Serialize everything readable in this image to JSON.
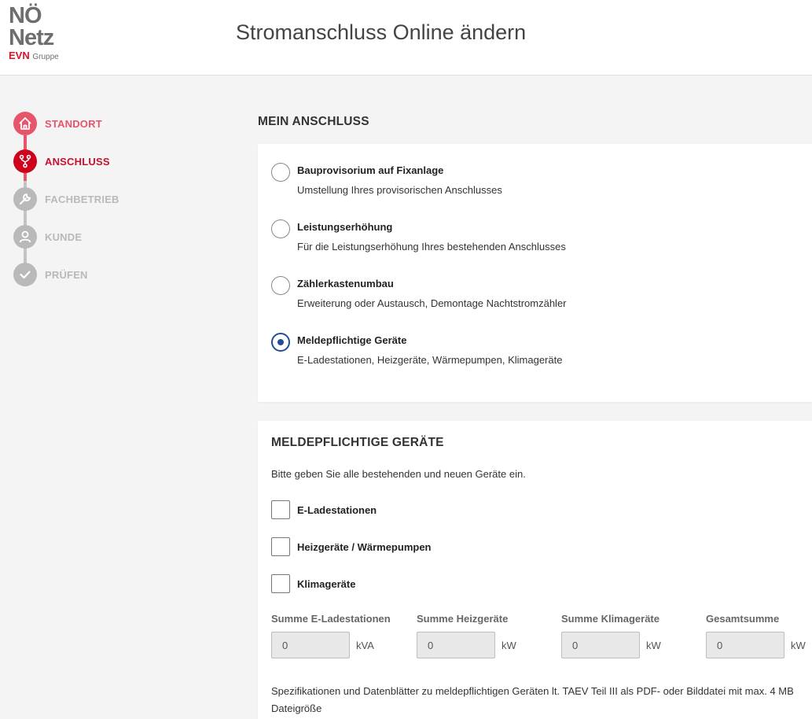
{
  "header": {
    "logo_line1": "NÖ",
    "logo_line2": "Netz",
    "logo_evn": "EVN",
    "logo_gruppe": "Gruppe",
    "title": "Stromanschluss Online ändern"
  },
  "stepper": {
    "steps": [
      {
        "label": "STANDORT",
        "icon": "house-icon",
        "state": "done"
      },
      {
        "label": "ANSCHLUSS",
        "icon": "fork-icon",
        "state": "active"
      },
      {
        "label": "FACHBETRIEB",
        "icon": "wrench-icon",
        "state": "todo"
      },
      {
        "label": "KUNDE",
        "icon": "person-icon",
        "state": "todo"
      },
      {
        "label": "PRÜFEN",
        "icon": "check-icon",
        "state": "todo"
      }
    ]
  },
  "mein_anschluss": {
    "heading": "MEIN ANSCHLUSS",
    "options": [
      {
        "title": "Bauprovisorium auf Fixanlage",
        "desc": "Umstellung Ihres provisorischen Anschlusses",
        "checked": false
      },
      {
        "title": "Leistungserhöhung",
        "desc": "Für die Leistungserhöhung Ihres bestehenden Anschlusses",
        "checked": false
      },
      {
        "title": "Zählerkastenumbau",
        "desc": "Erweiterung oder Austausch, Demontage Nachtstromzähler",
        "checked": false
      },
      {
        "title": "Meldepflichtige Geräte",
        "desc": "E-Ladestationen, Heizgeräte, Wärmepumpen, Klimageräte",
        "checked": true
      }
    ]
  },
  "geraete": {
    "heading": "MELDEPFLICHTIGE GERÄTE",
    "intro": "Bitte geben Sie alle bestehenden und neuen Geräte ein.",
    "checkboxes": [
      {
        "label": "E-Ladestationen",
        "checked": false
      },
      {
        "label": "Heizgeräte / Wärmepumpen",
        "checked": false
      },
      {
        "label": "Klimageräte",
        "checked": false
      }
    ],
    "sums": [
      {
        "label": "Summe E-Ladestationen",
        "value": "0",
        "unit": "kVA"
      },
      {
        "label": "Summe Heizgeräte",
        "value": "0",
        "unit": "kW"
      },
      {
        "label": "Summe Klimageräte",
        "value": "0",
        "unit": "kW"
      },
      {
        "label": "Gesamtsumme",
        "value": "0",
        "unit": "kW"
      }
    ],
    "spec_text": "Spezifikationen und Datenblätter zu meldepflichtigen Geräten lt. TAEV Teil III als PDF- oder Bilddatei mit max. 4 MB Dateigröße"
  },
  "colors": {
    "brand_red": "#d0021b",
    "done_pink": "#e8546a",
    "inactive_grey": "#b9b9b9",
    "radio_blue": "#1f4e9c"
  }
}
